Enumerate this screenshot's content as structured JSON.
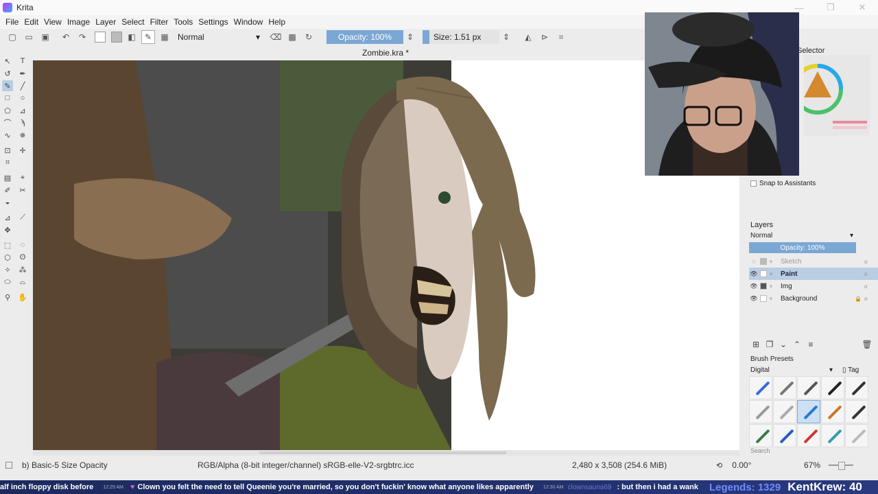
{
  "window": {
    "app_title": "Krita",
    "minimize": "—",
    "maximize": "❐",
    "close": "✕"
  },
  "menu": [
    "File",
    "Edit",
    "View",
    "Image",
    "Layer",
    "Select",
    "Filter",
    "Tools",
    "Settings",
    "Window",
    "Help"
  ],
  "toolbar": {
    "blend_mode": "Normal",
    "opacity": "Opacity: 100%",
    "size": "Size: 1.51 px"
  },
  "document": {
    "title": "Zombie.kra *"
  },
  "docker": {
    "color_selector_title": "Selector",
    "snap_label": "Snap to Assistants",
    "layers_title": "Layers",
    "layers_blend": "Normal",
    "layers_opacity": "Opacity:  100%",
    "layers": [
      {
        "name": "Sketch",
        "visible": false,
        "selected": false
      },
      {
        "name": "Paint",
        "visible": true,
        "selected": true
      },
      {
        "name": "Img",
        "visible": true,
        "selected": false
      },
      {
        "name": "Background",
        "visible": true,
        "selected": false,
        "locked": true
      }
    ],
    "presets_title": "Brush Presets",
    "presets_filter": "Digital",
    "presets_tag": "Tag",
    "search_placeholder": "Search"
  },
  "status": {
    "brush": "b) Basic-5 Size Opacity",
    "color_space": "RGB/Alpha (8-bit integer/channel)  sRGB-elle-V2-srgbtrc.icc",
    "image_size": "2,480 x 3,508 (254.6 MiB)",
    "rotation": "0.00°",
    "zoom": "67%"
  },
  "chat_ticker": {
    "msg1": "alf inch floppy disk before",
    "ts1": "12:29 AM",
    "msg2": "Clown you felt the need to tell Queenie you're married, so you don't fuckin' know what anyone likes apparently",
    "ts2": "12:30 AM",
    "user2": "clownsauna69",
    "msg3": ": but then i had a wank",
    "legends": "Legends: 1329",
    "counter": "KentKrew: 40"
  },
  "colors": {
    "accent": "#7ba7d4",
    "selected_row": "#b9cde3",
    "skin": "#d9cbbf",
    "hair": "#7c6a4f",
    "eye": "#2f4a33"
  }
}
